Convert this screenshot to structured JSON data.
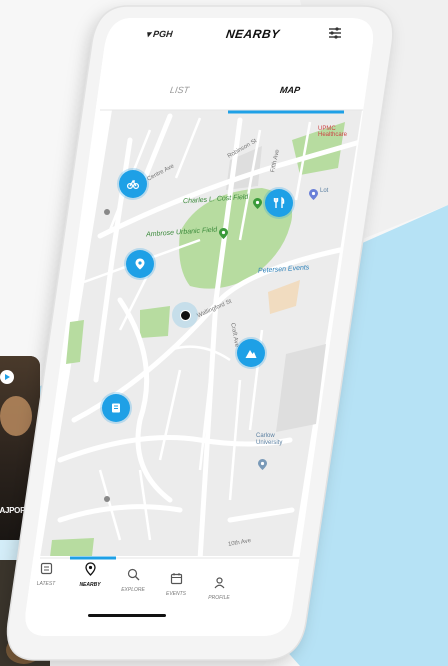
{
  "header": {
    "city": "PGH",
    "title": "NEARBY",
    "filter_icon": "filter-sliders-icon"
  },
  "tabs": [
    {
      "label": "LIST",
      "active": false
    },
    {
      "label": "MAP",
      "active": true
    }
  ],
  "map": {
    "labels": {
      "stadium": "Charles L. Cost Field",
      "urban_field": "Ambrose Urbanic Field",
      "events": "Petersen Events",
      "healthcare": "UPMC Healthcare",
      "university": "Carlow University",
      "street_centre": "Centre Ave",
      "street_bigelow": "Robinson St",
      "street_5th": "Fifth Ave",
      "street_centre2": "Centre Ave",
      "street_dithridge": "Craft Ave",
      "street_wallingford": "Wallingford St",
      "street_10th": "10th Ave",
      "lot_label": "Lot"
    },
    "pins": [
      {
        "icon": "bike-pin-icon"
      },
      {
        "icon": "info-pin-icon"
      },
      {
        "icon": "restaurant-pin-icon"
      },
      {
        "icon": "hiking-pin-icon"
      },
      {
        "icon": "book-pin-icon"
      }
    ]
  },
  "bottom_nav": [
    {
      "label": "LATEST",
      "icon": "latest-icon",
      "active": false
    },
    {
      "label": "NEARBY",
      "icon": "location-pin-icon",
      "active": true
    },
    {
      "label": "EXPLORE",
      "icon": "search-icon",
      "active": false
    },
    {
      "label": "EVENTS",
      "icon": "calendar-icon",
      "active": false
    },
    {
      "label": "PROFILE",
      "icon": "user-icon",
      "active": false
    }
  ],
  "side_card": {
    "label": "BAJPOPS"
  },
  "colors": {
    "accent": "#1ea0e6",
    "sky_bg": "#b6e2f5",
    "park_green": "#b7dca0",
    "map_bg": "#ececec",
    "road": "#ffffff"
  }
}
